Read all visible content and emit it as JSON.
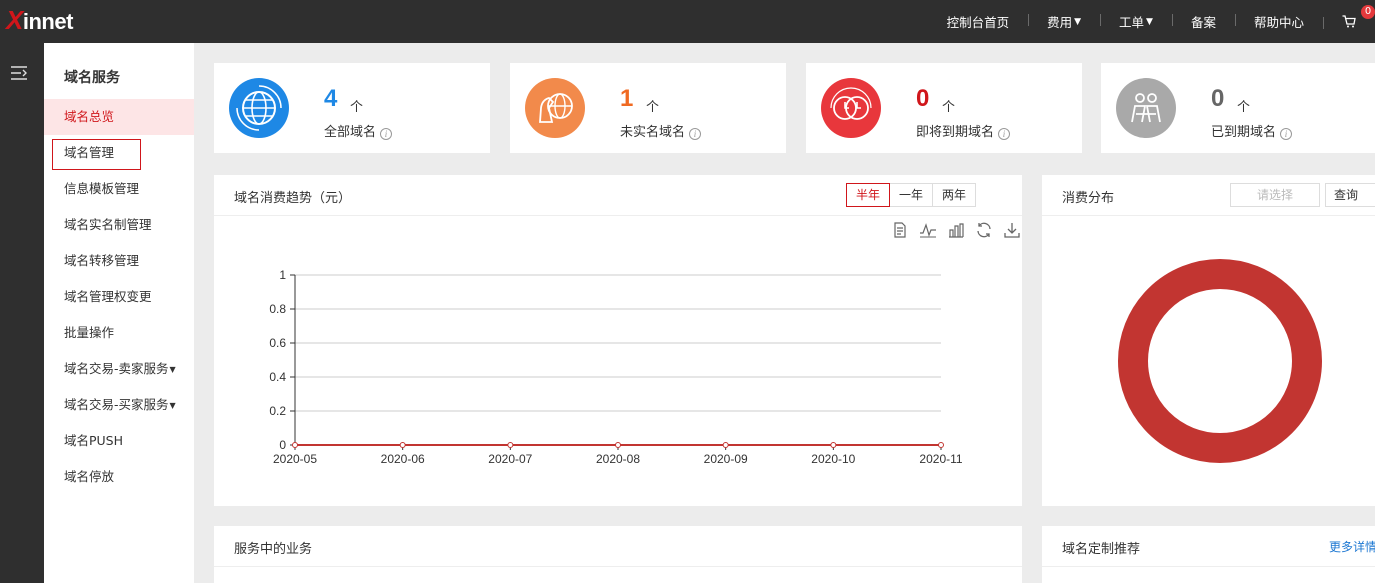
{
  "topbar": {
    "logo_x": "X",
    "logo_rest": "innet",
    "nav": [
      {
        "label": "控制台首页",
        "caret": false
      },
      {
        "label": "费用",
        "caret": true
      },
      {
        "label": "工单",
        "caret": true
      },
      {
        "label": "备案",
        "caret": false
      },
      {
        "label": "帮助中心",
        "caret": false
      }
    ],
    "cart_count": "0"
  },
  "sidebar": {
    "heading": "域名服务",
    "items": [
      {
        "label": "域名总览",
        "state": "active"
      },
      {
        "label": "域名管理",
        "state": "boxed"
      },
      {
        "label": "信息模板管理",
        "state": ""
      },
      {
        "label": "域名实名制管理",
        "state": ""
      },
      {
        "label": "域名转移管理",
        "state": ""
      },
      {
        "label": "域名管理权变更",
        "state": ""
      },
      {
        "label": "批量操作",
        "state": ""
      },
      {
        "label": "域名交易-卖家服务",
        "state": "dropdown"
      },
      {
        "label": "域名交易-买家服务",
        "state": "dropdown"
      },
      {
        "label": "域名PUSH",
        "state": ""
      },
      {
        "label": "域名停放",
        "state": ""
      }
    ]
  },
  "stats": [
    {
      "count": "4",
      "unit": "个",
      "label": "全部域名",
      "color": "#1e88e5",
      "icon": "globe-icon"
    },
    {
      "count": "1",
      "unit": "个",
      "label": "未实名域名",
      "color": "#f06a22",
      "icon": "unverified-icon"
    },
    {
      "count": "0",
      "unit": "个",
      "label": "即将到期域名",
      "color": "#d0161b",
      "icon": "clock-icon"
    },
    {
      "count": "0",
      "unit": "个",
      "label": "已到期域名",
      "color": "#666666",
      "icon": "expired-icon"
    }
  ],
  "trend_panel": {
    "title": "域名消费趋势（元）",
    "ranges": [
      "半年",
      "一年",
      "两年"
    ],
    "active_range": "半年"
  },
  "distribution_panel": {
    "title": "消费分布",
    "select_placeholder": "请选择",
    "query_label": "查询"
  },
  "services_panel": {
    "title": "服务中的业务"
  },
  "recommend_panel": {
    "title": "域名定制推荐",
    "more_label": "更多详情"
  },
  "chart_data": [
    {
      "type": "line",
      "x": [
        "2020-05",
        "2020-06",
        "2020-07",
        "2020-08",
        "2020-09",
        "2020-10",
        "2020-11"
      ],
      "series": [
        {
          "values": [
            0,
            0,
            0,
            0,
            0,
            0,
            0
          ],
          "color": "#c23531"
        }
      ],
      "yticks": [
        "0",
        "0.2",
        "0.4",
        "0.6",
        "0.8",
        "1"
      ],
      "ylim": [
        0,
        1
      ],
      "grid": true
    },
    {
      "type": "pie",
      "slices": [
        {
          "value": 1,
          "color": "#c23531"
        }
      ],
      "donut": true
    }
  ]
}
